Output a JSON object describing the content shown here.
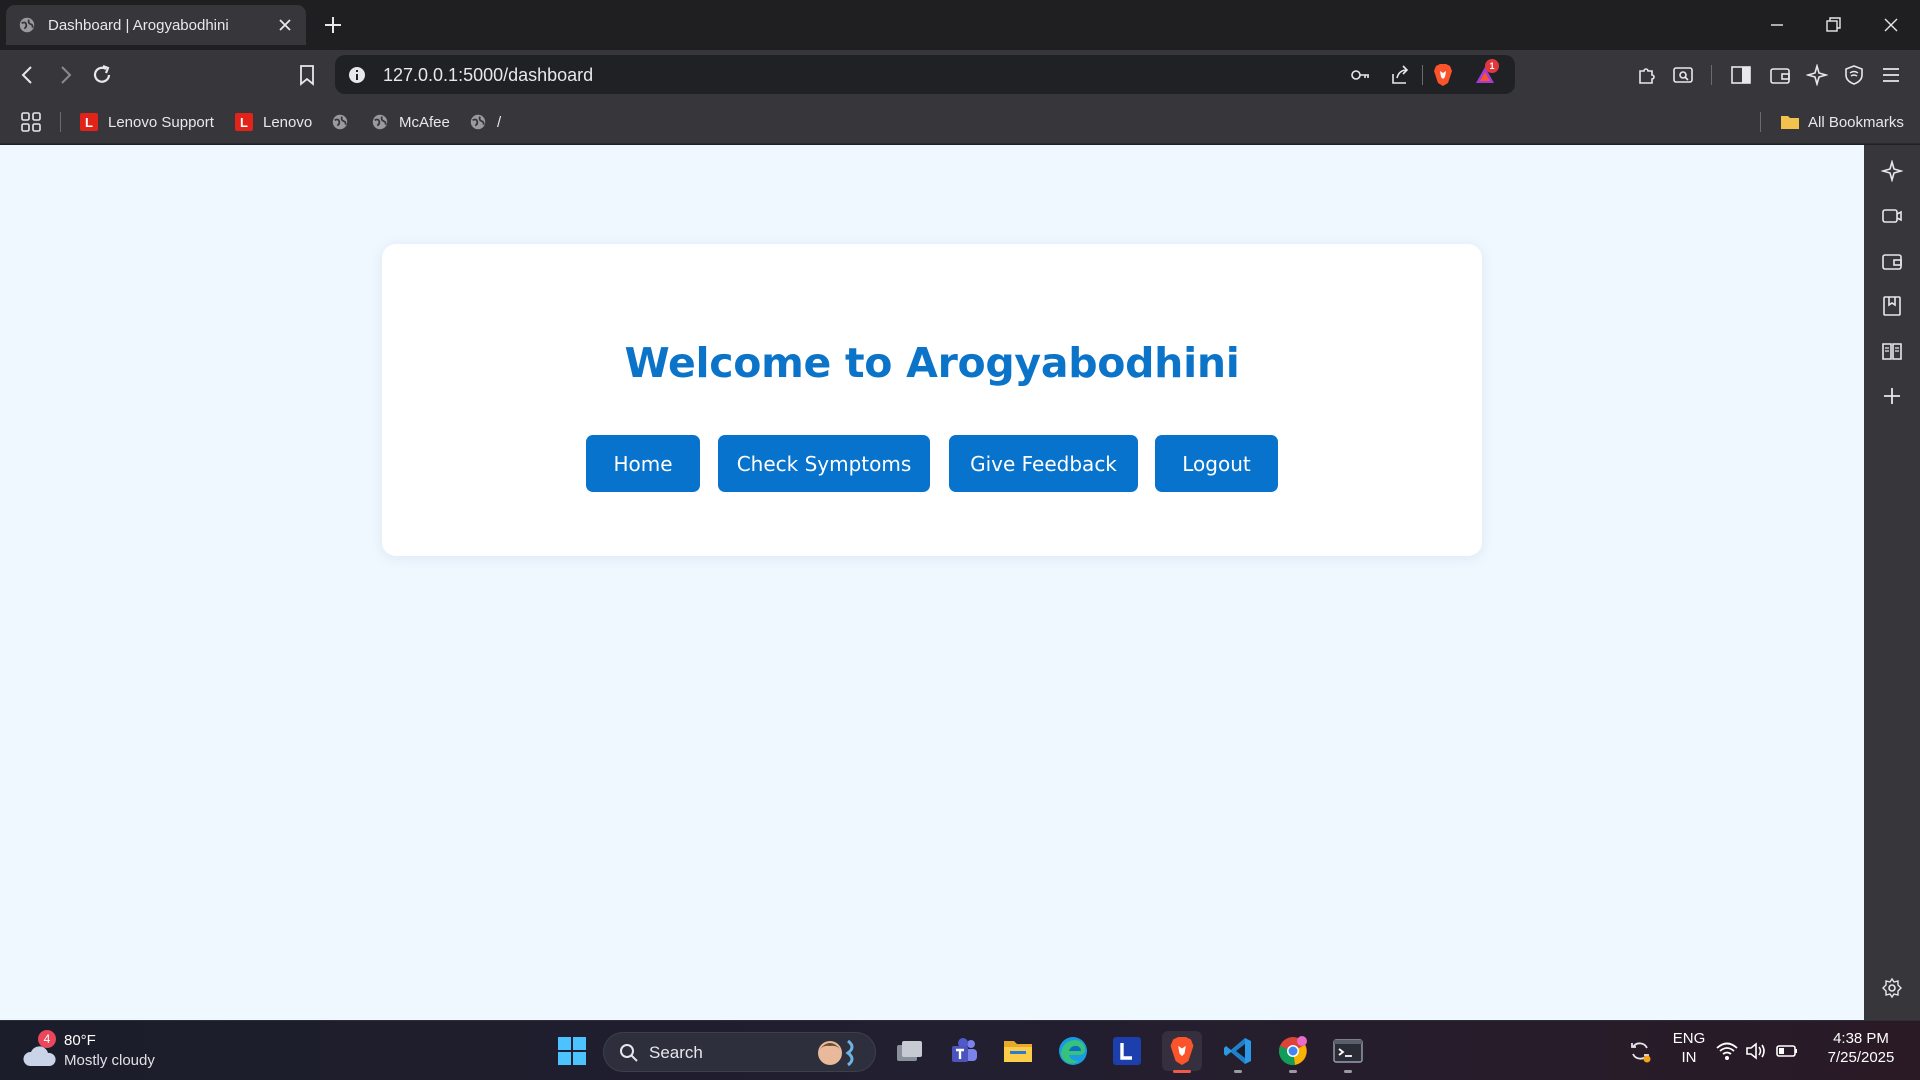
{
  "browser": {
    "tab_title": "Dashboard | Arogyabodhini",
    "url": "127.0.0.1:5000/dashboard",
    "shield_badge": "1",
    "bookmarks": [
      {
        "label": "Lenovo Support",
        "icon": "lenovo-logo",
        "logo_letter": "L"
      },
      {
        "label": "Lenovo",
        "icon": "lenovo-logo",
        "logo_letter": "L"
      },
      {
        "label": "",
        "icon": "globe-icon"
      },
      {
        "label": "McAfee",
        "icon": "globe-icon"
      },
      {
        "label": "/",
        "icon": "globe-icon"
      }
    ],
    "all_bookmarks_label": "All Bookmarks"
  },
  "page": {
    "heading": "Welcome to Arogyabodhini",
    "nav_buttons": [
      "Home",
      "Check Symptoms",
      "Give Feedback",
      "Logout"
    ],
    "colors": {
      "accent": "#0873cd",
      "heading": "#0b74c9",
      "background": "#eff7ff",
      "card": "#ffffff"
    }
  },
  "taskbar": {
    "weather_temp": "80°F",
    "weather_condition": "Mostly cloudy",
    "weather_badge": "4",
    "search_label": "Search",
    "language_top": "ENG",
    "language_bottom": "IN",
    "time": "4:38 PM",
    "date": "7/25/2025"
  }
}
